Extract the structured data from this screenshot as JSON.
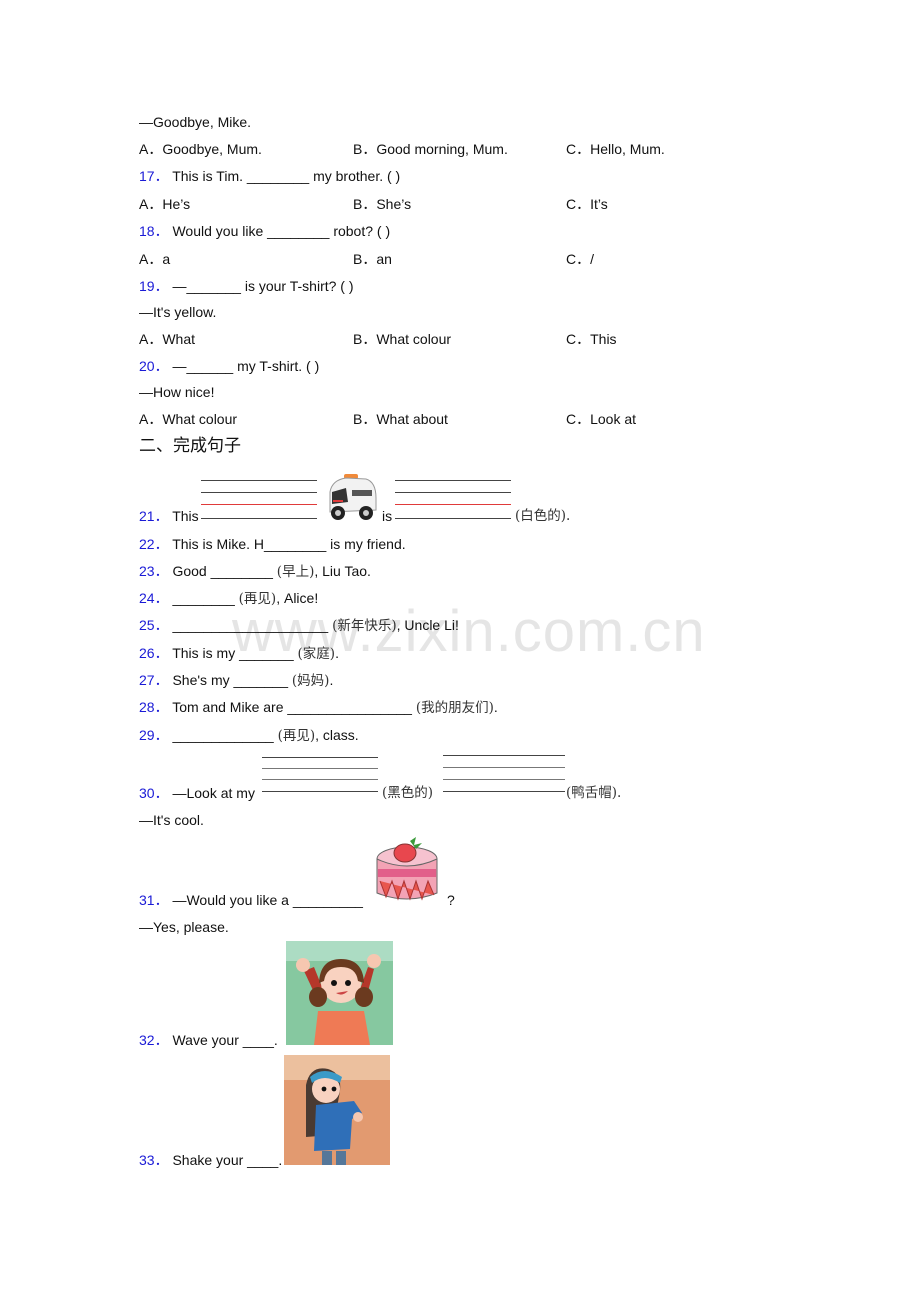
{
  "q16": {
    "response": "—Goodbye, Mike.",
    "options": [
      "A．Goodbye, Mum.",
      "B．Good morning, Mum.",
      "C．Hello, Mum."
    ]
  },
  "q17": {
    "num": "17．",
    "text": "This is Tim. ________ my brother. (     )",
    "options": [
      "A．He’s",
      "B．She’s",
      "C．It’s"
    ]
  },
  "q18": {
    "num": "18．",
    "text": "Would you like ________ robot? (    )",
    "options": [
      "A．a",
      "B．an",
      "C．/"
    ]
  },
  "q19": {
    "num": "19．",
    "text": "—_______ is your T-shirt? (   )",
    "response": "—It's yellow.",
    "options": [
      "A．What",
      "B．What colour",
      "C．This"
    ]
  },
  "q20": {
    "num": "20．",
    "text": "—______ my T-shirt. (   )",
    "response": "—How nice!",
    "options": [
      "A．What colour",
      "B．What about",
      "C．Look at"
    ]
  },
  "section2": {
    "title": "二、完成句子"
  },
  "q21": {
    "num": "21．",
    "pre": "This",
    "mid": "is",
    "hint": "(白色的).",
    "image": "toy-van-picture"
  },
  "q22": {
    "num": "22．",
    "text": "This is Mike. H________ is my friend."
  },
  "q23": {
    "num": "23．",
    "pre": "Good ________ ",
    "hint": "(早上)",
    "post": ", Liu Tao."
  },
  "q24": {
    "num": "24．",
    "pre": "________ ",
    "hint": "(再见)",
    "post": ", Alice!"
  },
  "q25": {
    "num": "25．",
    "pre": "____________________ ",
    "hint": "(新年快乐)",
    "post": ", Uncle Li!"
  },
  "q26": {
    "num": "26．",
    "pre": "This is my _______ ",
    "hint": "(家庭)",
    "post": "."
  },
  "q27": {
    "num": "27．",
    "pre": "She's my _______ ",
    "hint": "(妈妈)",
    "post": "."
  },
  "q28": {
    "num": "28．",
    "pre": "Tom and Mike are ________________ ",
    "hint": "(我的朋友们)",
    "post": "."
  },
  "q29": {
    "num": "29．",
    "pre": "_____________ ",
    "hint": "(再见)",
    "post": ", class."
  },
  "q30": {
    "num": "30．",
    "pre": "—Look at my",
    "hint1": "(黑色的)",
    "hint2": "(鸭舌帽).",
    "response": "—It's cool."
  },
  "q31": {
    "num": "31．",
    "text": "—Would you like a _________",
    "end": "?",
    "response": "—Yes, please."
  },
  "q32": {
    "num": "32．",
    "text": "Wave your ____."
  },
  "q33": {
    "num": "33．",
    "text": "Shake your ____."
  },
  "watermark": "www.zixin.com.cn"
}
